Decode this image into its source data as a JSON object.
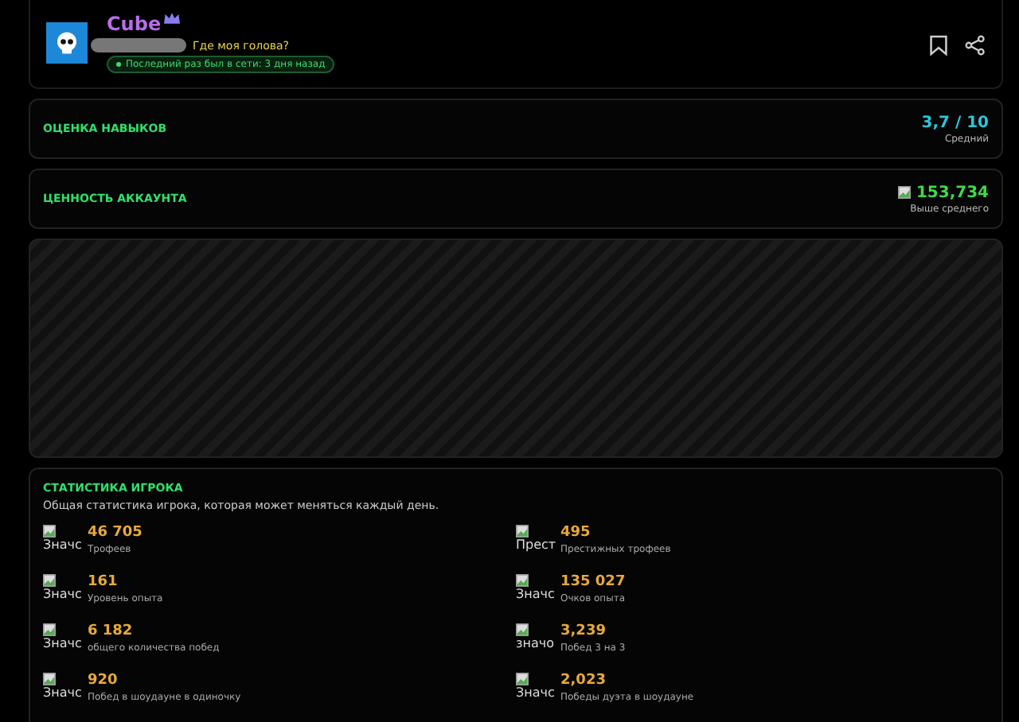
{
  "profile": {
    "name": "Cube",
    "status_text": "Где моя голова?",
    "last_seen": "Последний раз был в сети: 3 дня назад"
  },
  "ratings": [
    {
      "title": "ОЦЕНКА НАВЫКОВ",
      "value": "3,7 / 10",
      "caption": "Средний",
      "kind": "score"
    },
    {
      "title": "ЦЕННОСТЬ АККАУНТА",
      "value": "153,734",
      "caption": "Выше среднего",
      "kind": "worth"
    }
  ],
  "stats": {
    "title": "СТАТИСТИКА ИГРОКА",
    "subtitle": "Общая статистика игрока, которая может меняться каждый день.",
    "items": [
      {
        "alt": "Значс",
        "value": "46 705",
        "label": "Трофеев"
      },
      {
        "alt": "Прест",
        "value": "495",
        "label": "Престижных трофеев"
      },
      {
        "alt": "Значс",
        "value": "161",
        "label": "Уровень опыта"
      },
      {
        "alt": "Значс",
        "value": "135 027",
        "label": "Очков опыта"
      },
      {
        "alt": "Значс",
        "value": "6 182",
        "label": "общего количества побед"
      },
      {
        "alt": "значо",
        "value": "3,239",
        "label": "Побед 3 на 3"
      },
      {
        "alt": "Значс",
        "value": "920",
        "label": "Побед в шоудауне в одиночку"
      },
      {
        "alt": "Значс",
        "value": "2,023",
        "label": "Победы дуэта в шоудауне"
      }
    ]
  }
}
